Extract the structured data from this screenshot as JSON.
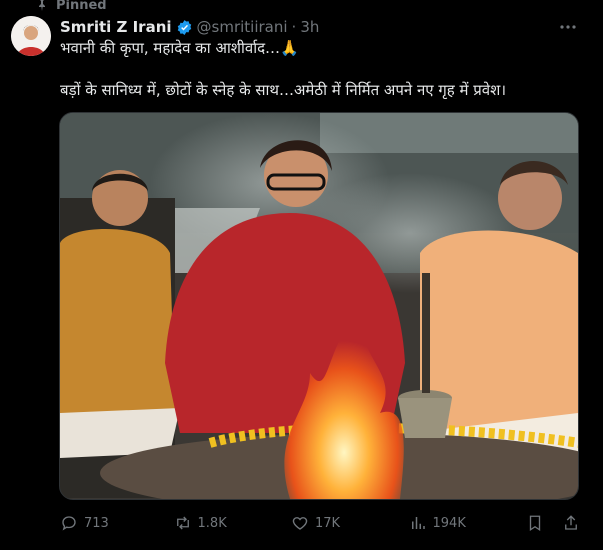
{
  "pinned_label": "Pinned",
  "author": {
    "name": "Smriti Z Irani",
    "handle": "@smritiirani",
    "separator": "·",
    "time": "3h"
  },
  "tweet": {
    "line1": "भवानी की कृपा, महादेव का आशीर्वाद…🙏",
    "line2": "बड़ों के सानिध्य में, छोटों के स्नेह के साथ…अमेठी में निर्मित अपने नए गृह में प्रवेश।"
  },
  "stats": {
    "replies": "713",
    "reposts": "1.8K",
    "likes": "17K",
    "views": "194K"
  },
  "icons": {
    "pin": "pin-icon",
    "verified": "verified-badge-icon",
    "more": "more-options-icon",
    "reply": "reply-icon",
    "repost": "repost-icon",
    "like": "heart-icon",
    "views": "views-chart-icon",
    "bookmark": "bookmark-icon",
    "share": "share-icon"
  },
  "colors": {
    "background": "#000000",
    "text": "#e7e9ea",
    "muted": "#71767b",
    "verified": "#1d9bf0"
  }
}
